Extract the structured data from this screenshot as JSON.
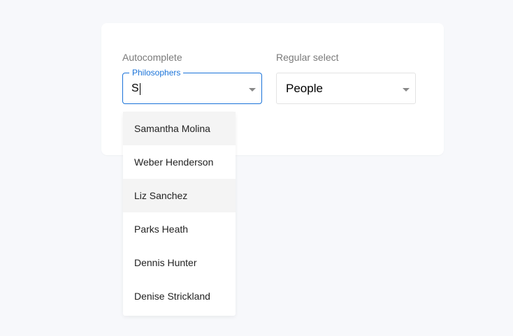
{
  "labels": {
    "autocomplete": "Autocomplete",
    "regular_select": "Regular select"
  },
  "autocomplete": {
    "legend": "Philosophers",
    "value": "S"
  },
  "regular_select": {
    "value": "People"
  },
  "dropdown": {
    "options": [
      {
        "label": "Samantha Molina",
        "highlighted": true
      },
      {
        "label": "Weber Henderson",
        "highlighted": false
      },
      {
        "label": "Liz Sanchez",
        "highlighted": true
      },
      {
        "label": "Parks Heath",
        "highlighted": false
      },
      {
        "label": "Dennis Hunter",
        "highlighted": false
      },
      {
        "label": "Denise Strickland",
        "highlighted": false
      }
    ]
  },
  "colors": {
    "accent": "#1a73d9",
    "background": "#f7f8fb",
    "option_highlight": "#f4f4f4"
  }
}
